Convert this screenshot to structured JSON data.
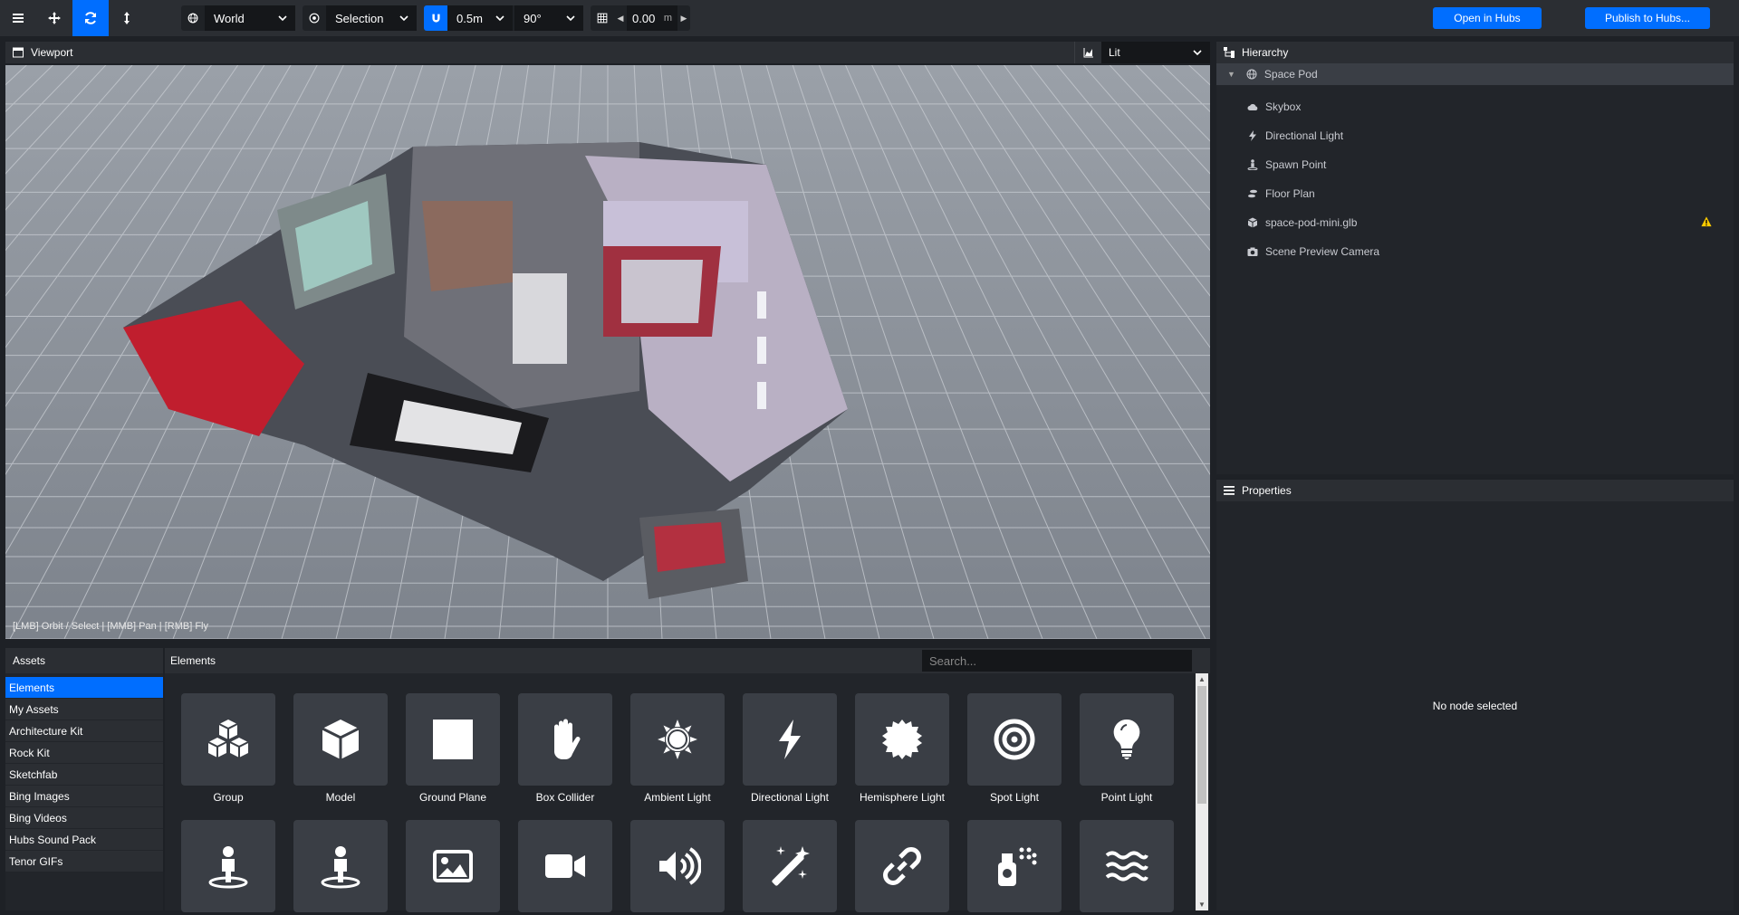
{
  "toolbar": {
    "space_label": "World",
    "snap_label": "Selection",
    "translate_snap": "0.5m",
    "rotate_snap": "90°",
    "grid_height": "0.00",
    "grid_unit": "m",
    "open_hubs_label": "Open in Hubs",
    "publish_label": "Publish to Hubs..."
  },
  "viewport": {
    "title": "Viewport",
    "render_mode": "Lit",
    "help_text": "[LMB] Orbit / Select | [MMB] Pan | [RMB] Fly"
  },
  "hierarchy": {
    "title": "Hierarchy",
    "root": "Space Pod",
    "items": [
      {
        "label": "Skybox",
        "icon": "cloud-icon"
      },
      {
        "label": "Directional Light",
        "icon": "bolt-icon"
      },
      {
        "label": "Spawn Point",
        "icon": "person-icon"
      },
      {
        "label": "Floor Plan",
        "icon": "shoe-prints-icon"
      },
      {
        "label": "space-pod-mini.glb",
        "icon": "cube-icon"
      },
      {
        "label": "Scene Preview Camera",
        "icon": "camera-icon"
      }
    ]
  },
  "properties": {
    "title": "Properties",
    "empty_text": "No node selected"
  },
  "assets": {
    "title": "Assets",
    "sources": [
      "Elements",
      "My Assets",
      "Architecture Kit",
      "Rock Kit",
      "Sketchfab",
      "Bing Images",
      "Bing Videos",
      "Hubs Sound Pack",
      "Tenor GIFs"
    ]
  },
  "elements": {
    "title": "Elements",
    "search_placeholder": "Search...",
    "items": [
      "Group",
      "Model",
      "Ground Plane",
      "Box Collider",
      "Ambient Light",
      "Directional Light",
      "Hemisphere Light",
      "Spot Light",
      "Point Light"
    ]
  },
  "colors": {
    "accent": "#006eff",
    "panel": "#22252a",
    "toolbar": "#2b2e33",
    "tile": "#3a3e45",
    "warning": "#ffcc00"
  }
}
